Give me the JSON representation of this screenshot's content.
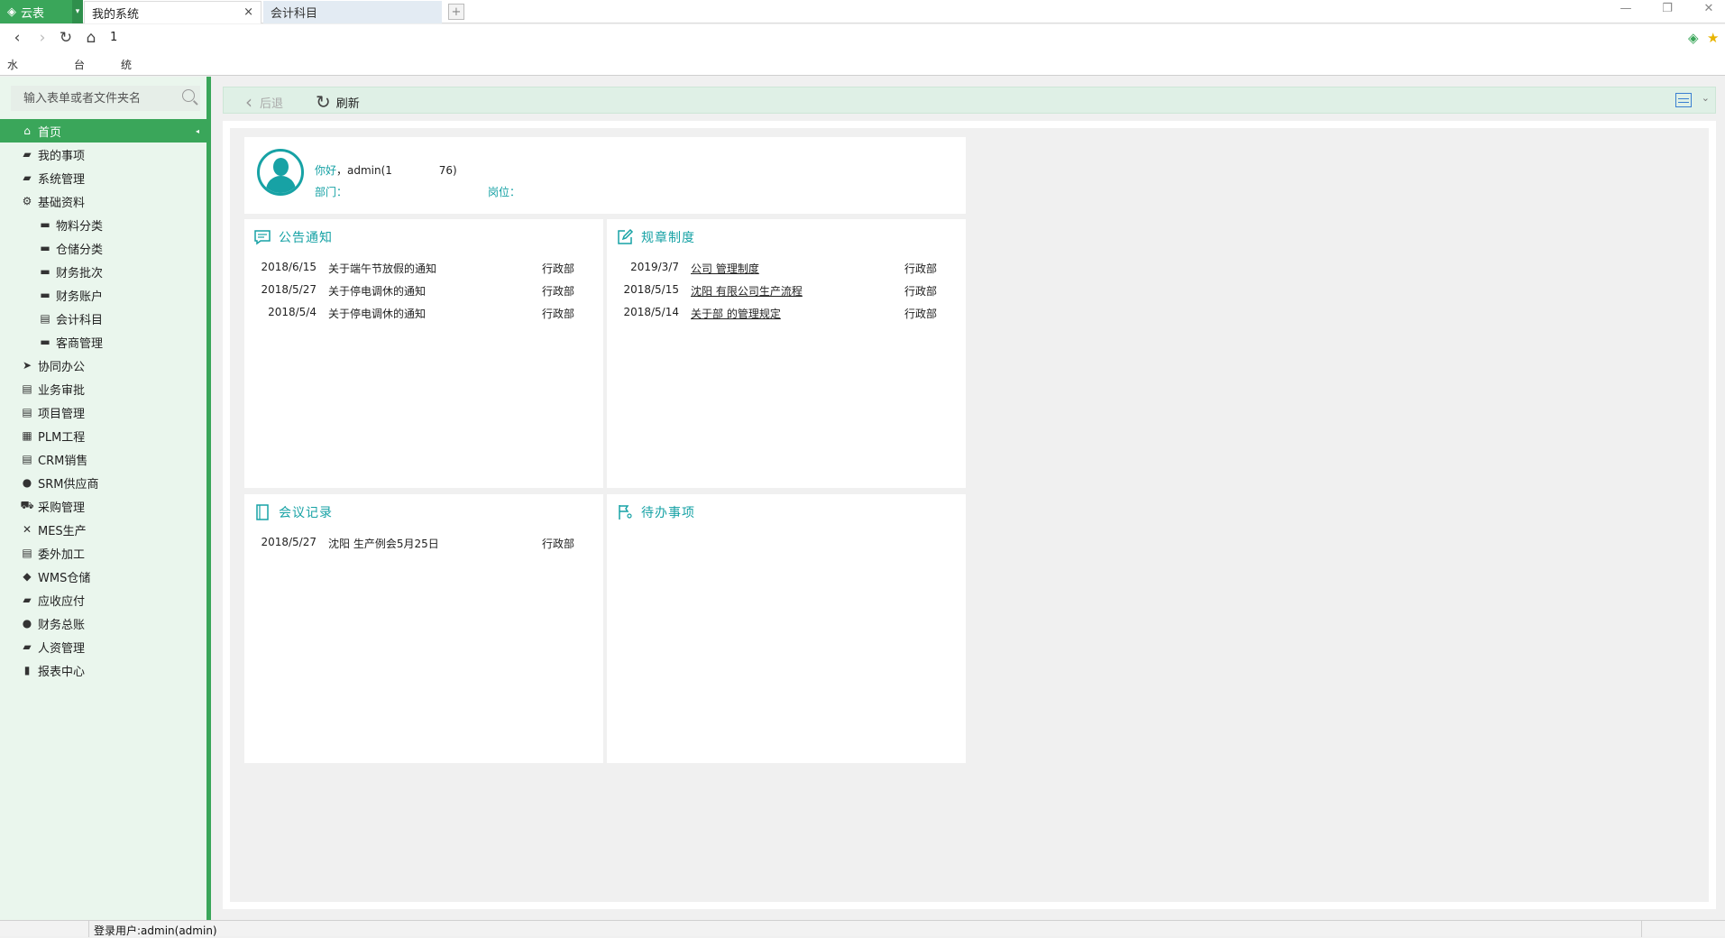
{
  "browser": {
    "brand": "云表",
    "tabs": [
      {
        "label": "我的系统",
        "active": true
      },
      {
        "label": "会计科目",
        "active": false
      }
    ],
    "url": "1",
    "bookmarks": [
      "水",
      "台",
      "统"
    ]
  },
  "sidebar": {
    "search_placeholder": "输入表单或者文件夹名",
    "items": [
      {
        "label": "首页",
        "icon": "home-icon",
        "glyph": "⌂",
        "level": 1,
        "active": true
      },
      {
        "label": "我的事项",
        "icon": "folder-open-icon",
        "glyph": "▰",
        "level": 1
      },
      {
        "label": "系统管理",
        "icon": "folder-icon",
        "glyph": "▰",
        "level": 1
      },
      {
        "label": "基础资料",
        "icon": "gear-icon",
        "glyph": "⚙",
        "level": 1
      },
      {
        "label": "物料分类",
        "icon": "card-icon",
        "glyph": "▬",
        "level": 2
      },
      {
        "label": "仓储分类",
        "icon": "card-icon",
        "glyph": "▬",
        "level": 2
      },
      {
        "label": "财务批次",
        "icon": "card-icon",
        "glyph": "▬",
        "level": 2
      },
      {
        "label": "财务账户",
        "icon": "card-icon",
        "glyph": "▬",
        "level": 2
      },
      {
        "label": "会计科目",
        "icon": "clipboard-icon",
        "glyph": "▤",
        "level": 2
      },
      {
        "label": "客商管理",
        "icon": "card-icon",
        "glyph": "▬",
        "level": 2
      },
      {
        "label": "协同办公",
        "icon": "send-icon",
        "glyph": "➤",
        "level": 1
      },
      {
        "label": "业务审批",
        "icon": "document-icon",
        "glyph": "▤",
        "level": 1
      },
      {
        "label": "项目管理",
        "icon": "document-icon",
        "glyph": "▤",
        "level": 1
      },
      {
        "label": "PLM工程",
        "icon": "table-icon",
        "glyph": "▦",
        "level": 1
      },
      {
        "label": "CRM销售",
        "icon": "list-icon",
        "glyph": "▤",
        "level": 1
      },
      {
        "label": "SRM供应商",
        "icon": "user-icon",
        "glyph": "●",
        "level": 1
      },
      {
        "label": "采购管理",
        "icon": "cart-icon",
        "glyph": "⛟",
        "level": 1
      },
      {
        "label": "MES生产",
        "icon": "tools-icon",
        "glyph": "✕",
        "level": 1
      },
      {
        "label": "委外加工",
        "icon": "clipboard-icon",
        "glyph": "▤",
        "level": 1
      },
      {
        "label": "WMS仓储",
        "icon": "tag-icon",
        "glyph": "◆",
        "level": 1
      },
      {
        "label": "应收应付",
        "icon": "wallet-icon",
        "glyph": "▰",
        "level": 1
      },
      {
        "label": "财务总账",
        "icon": "money-bag-icon",
        "glyph": "●",
        "level": 1
      },
      {
        "label": "人资管理",
        "icon": "chat-icon",
        "glyph": "▰",
        "level": 1
      },
      {
        "label": "报表中心",
        "icon": "bar-chart-icon",
        "glyph": "▮",
        "level": 1
      }
    ]
  },
  "toolbar": {
    "back_label": "后退",
    "refresh_label": "刷新"
  },
  "user": {
    "greeting_label": "你好",
    "name": "，admin(1",
    "name_suffix": "76)",
    "dept_label": "部门：",
    "dept_value": "",
    "post_label": "岗位："
  },
  "panels": {
    "notice": {
      "title": "公告通知",
      "rows": [
        {
          "date": "2018/6/15",
          "title": "关于端午节放假的通知",
          "dept": "行政部"
        },
        {
          "date": "2018/5/27",
          "title": "关于停电调休的通知",
          "dept": "行政部"
        },
        {
          "date": "2018/5/4",
          "title": "关于停电调休的通知",
          "dept": "行政部"
        }
      ]
    },
    "rules": {
      "title": "规章制度",
      "rows": [
        {
          "date": "2019/3/7",
          "title": "公司 管理制度",
          "dept": "行政部"
        },
        {
          "date": "2018/5/15",
          "title": "沈阳 有限公司生产流程",
          "dept": "行政部"
        },
        {
          "date": "2018/5/14",
          "title": "关于部 的管理规定",
          "dept": "行政部"
        }
      ]
    },
    "meeting": {
      "title": "会议记录",
      "rows": [
        {
          "date": "2018/5/27",
          "title": "沈阳 生产例会5月25日",
          "dept": "行政部"
        }
      ]
    },
    "todo": {
      "title": "待办事项",
      "rows": []
    }
  },
  "statusbar": {
    "user": "登录用户:admin(admin)"
  }
}
